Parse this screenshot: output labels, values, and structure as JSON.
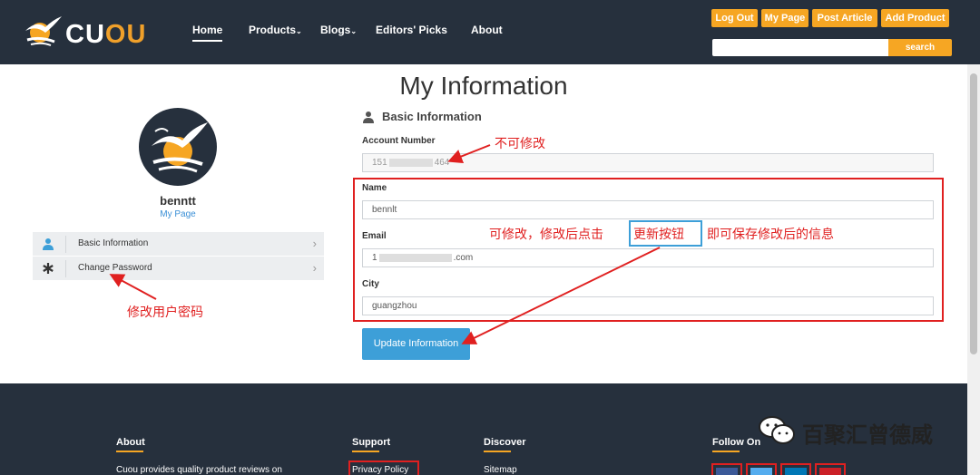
{
  "header": {
    "logo_text_prefix": "CU",
    "logo_text_accent": "OU",
    "nav": [
      {
        "label": "Home"
      },
      {
        "label": "Products"
      },
      {
        "label": "Blogs"
      },
      {
        "label": "Editors' Picks"
      },
      {
        "label": "About"
      }
    ],
    "buttons": {
      "logout": "Log Out",
      "my_page": "My Page",
      "post_article": "Post Article",
      "add_product": "Add Product"
    },
    "search": {
      "placeholder": "",
      "button": "search"
    }
  },
  "page_title": "My Information",
  "profile": {
    "username": "benntt",
    "my_page_link": "My Page",
    "menu": [
      {
        "label": "Basic Information",
        "icon": "user-icon"
      },
      {
        "label": "Change Password",
        "icon": "asterisk-icon"
      }
    ]
  },
  "form": {
    "section_title": "Basic Information",
    "account_number": {
      "label": "Account Number",
      "value_prefix": "151",
      "value_suffix": "464"
    },
    "name": {
      "label": "Name",
      "value": "bennlt"
    },
    "email": {
      "label": "Email",
      "value_prefix": "1",
      "value_suffix": ".com"
    },
    "city": {
      "label": "City",
      "value": "guangzhou"
    },
    "update_button": "Update Information"
  },
  "annotations": {
    "not_editable": "不可修改",
    "editable_hint_before": "可修改，修改后点击",
    "editable_hint_button": "更新按钮",
    "editable_hint_after": "即可保存修改后的信息",
    "change_password": "修改用户密码"
  },
  "footer": {
    "about_heading": "About",
    "about_text": "Cuou provides quality product reviews on",
    "support_heading": "Support",
    "support_link": "Privacy Policy",
    "discover_heading": "Discover",
    "discover_link": "Sitemap",
    "follow_heading": "Follow On"
  },
  "watermark": "百聚汇曾德威",
  "colors": {
    "header_bg": "#26303d",
    "accent": "#f6a623",
    "button_blue": "#3d9fd8",
    "annotation_red": "#e02020"
  }
}
